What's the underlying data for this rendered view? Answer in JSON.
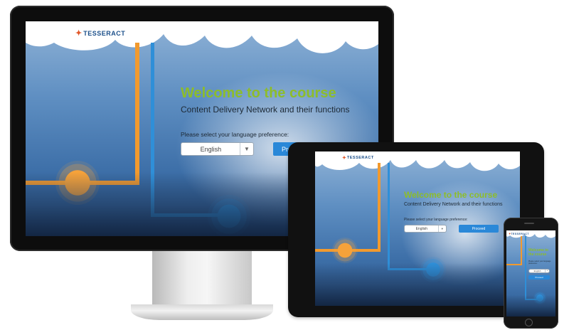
{
  "course": {
    "welcome": "Welcome to the course",
    "subtitle": "Content Delivery Network and their functions",
    "language_prompt": "Please select your language preference:",
    "language_selected": "English",
    "proceed_label": "Proceed",
    "proceed_label_truncated": "Pro"
  },
  "brand": {
    "name": "TESSERACT",
    "accent_green": "#8dbd2a",
    "accent_orange": "#f29a2e",
    "accent_blue": "#2a88d8"
  },
  "icons": {
    "dropdown": "chevron-down-icon",
    "logo": "tesseract-logo-icon",
    "network_hub": "network-hub-icon",
    "server": "server-icon",
    "home": "home-icon"
  }
}
